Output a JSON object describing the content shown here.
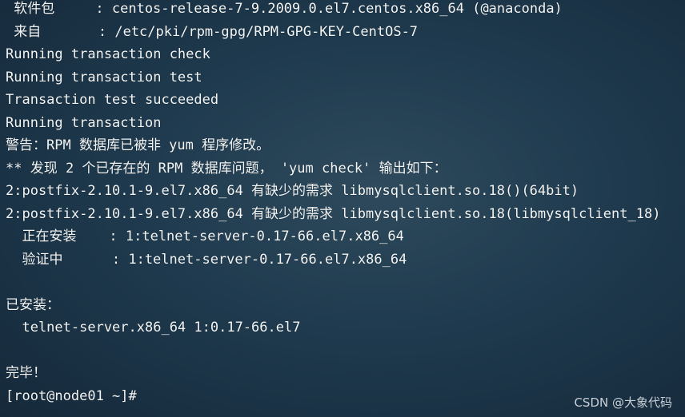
{
  "terminal": {
    "lines": [
      " 软件包     : centos-release-7-9.2009.0.el7.centos.x86_64 (@anaconda)",
      " 来自       : /etc/pki/rpm-gpg/RPM-GPG-KEY-CentOS-7",
      "Running transaction check",
      "Running transaction test",
      "Transaction test succeeded",
      "Running transaction",
      "警告：RPM 数据库已被非 yum 程序修改。",
      "** 发现 2 个已存在的 RPM 数据库问题， 'yum check' 输出如下：",
      "2:postfix-2.10.1-9.el7.x86_64 有缺少的需求 libmysqlclient.so.18()(64bit)",
      "2:postfix-2.10.1-9.el7.x86_64 有缺少的需求 libmysqlclient.so.18(libmysqlclient_18)",
      "  正在安装    : 1:telnet-server-0.17-66.el7.x86_64",
      "  验证中      : 1:telnet-server-0.17-66.el7.x86_64",
      "",
      "已安装：",
      "  telnet-server.x86_64 1:0.17-66.el7",
      "",
      "完毕！",
      "[root@node01 ~]# "
    ]
  },
  "watermark": {
    "text": "CSDN @大象代码"
  }
}
